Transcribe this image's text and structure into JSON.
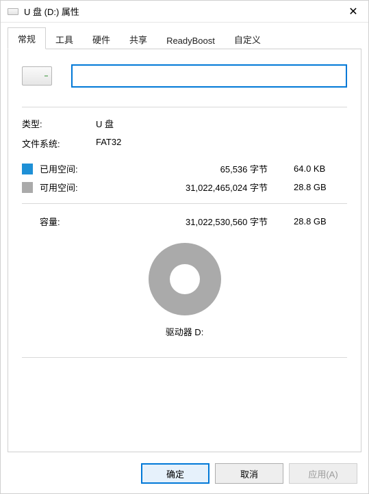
{
  "titlebar": {
    "title": "U 盘 (D:) 属性",
    "close_label": "✕"
  },
  "tabs": [
    {
      "label": "常规"
    },
    {
      "label": "工具"
    },
    {
      "label": "硬件"
    },
    {
      "label": "共享"
    },
    {
      "label": "ReadyBoost"
    },
    {
      "label": "自定义"
    }
  ],
  "general": {
    "label_value": "",
    "type_key": "类型:",
    "type_val": "U 盘",
    "fs_key": "文件系统:",
    "fs_val": "FAT32",
    "used": {
      "label": "已用空间:",
      "bytes": "65,536 字节",
      "human": "64.0 KB",
      "color": "#1e90d6"
    },
    "free": {
      "label": "可用空间:",
      "bytes": "31,022,465,024 字节",
      "human": "28.8 GB",
      "color": "#aaaaaa"
    },
    "capacity": {
      "label": "容量:",
      "bytes": "31,022,530,560 字节",
      "human": "28.8 GB"
    },
    "drive_caption": "驱动器 D:"
  },
  "buttons": {
    "ok": "确定",
    "cancel": "取消",
    "apply": "应用(A)"
  }
}
